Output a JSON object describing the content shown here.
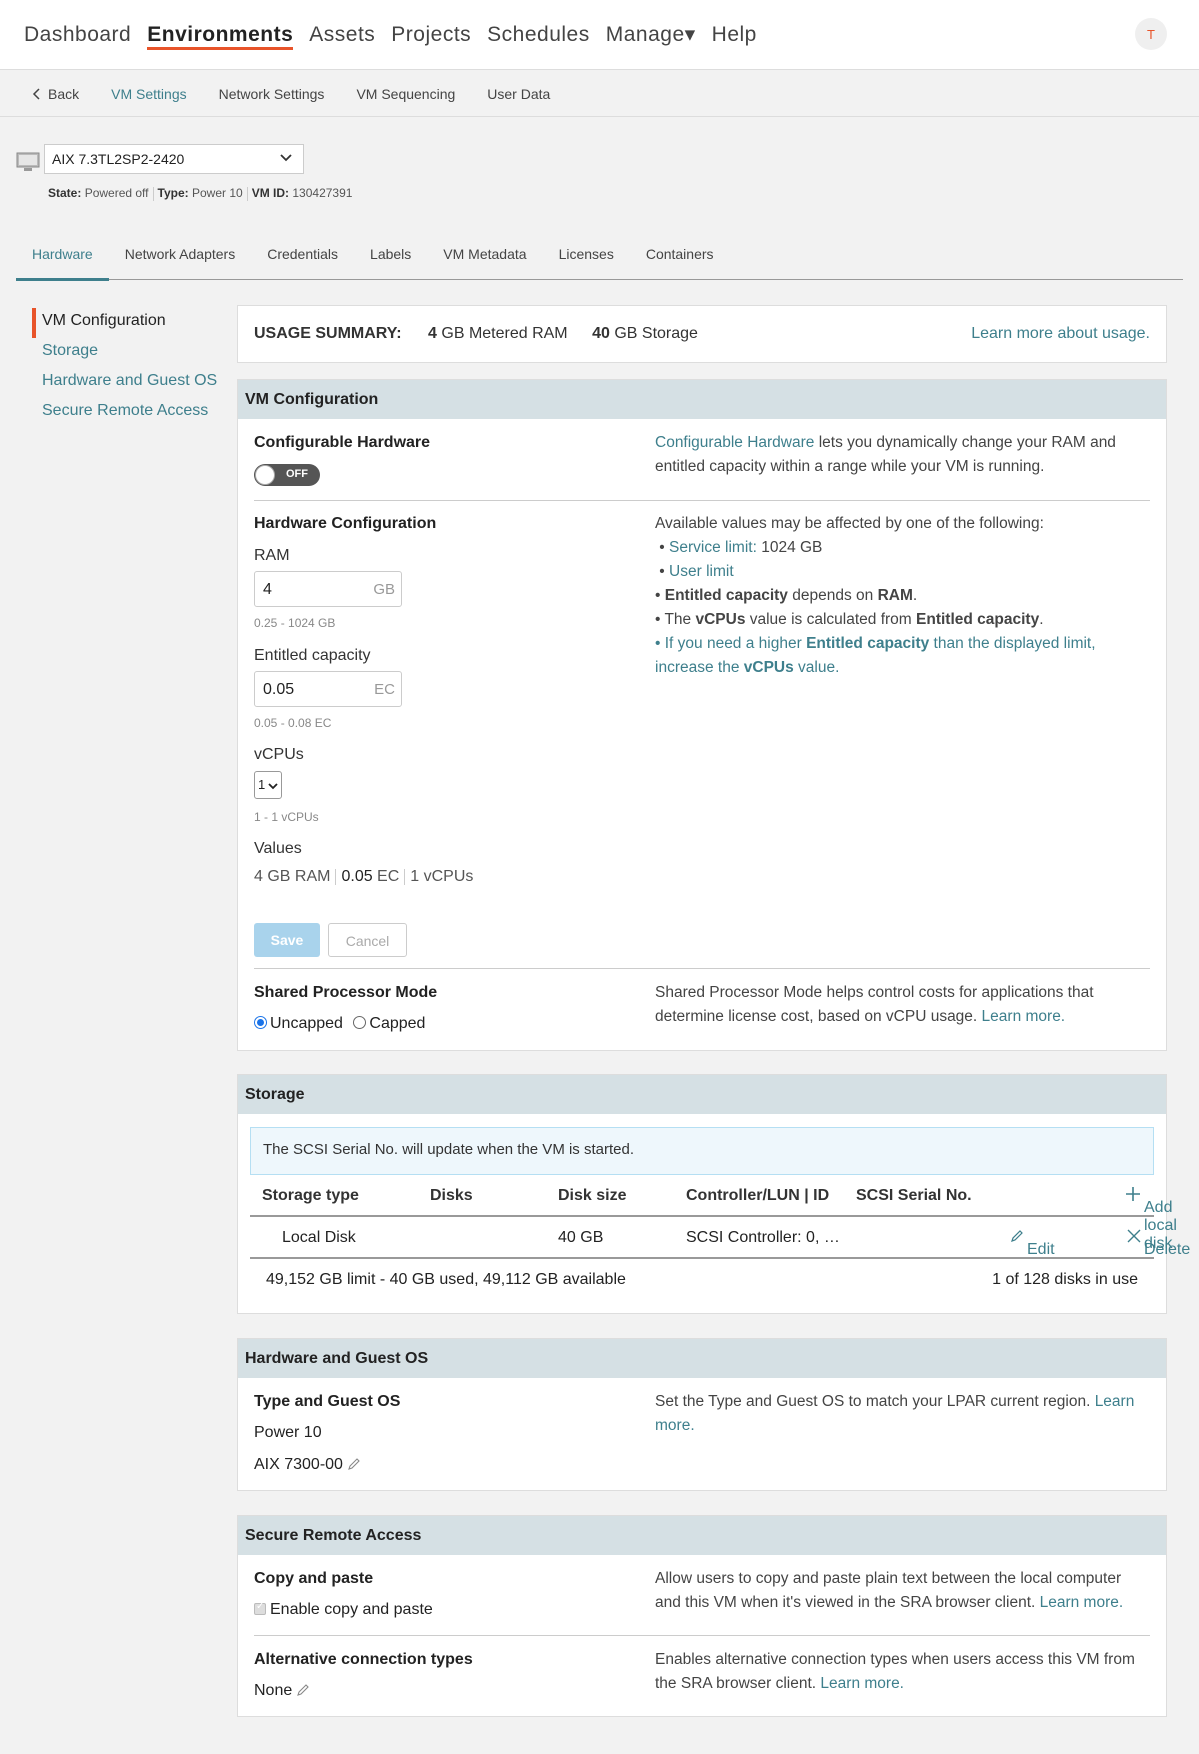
{
  "topnav": {
    "items": [
      "Dashboard",
      "Environments",
      "Assets",
      "Projects",
      "Schedules",
      "Manage▾",
      "Help"
    ],
    "avatar": "T"
  },
  "subnav": {
    "back": "Back",
    "items": [
      "VM Settings",
      "Network Settings",
      "VM Sequencing",
      "User Data"
    ]
  },
  "vm": {
    "name": "AIX 7.3TL2SP2-2420",
    "state_label": "State:",
    "state": "Powered off",
    "type_label": "Type:",
    "type": "Power 10",
    "id_label": "VM ID:",
    "id": "130427391"
  },
  "tabs": [
    "Hardware",
    "Network Adapters",
    "Credentials",
    "Labels",
    "VM Metadata",
    "Licenses",
    "Containers"
  ],
  "sidenav": [
    "VM Configuration",
    "Storage",
    "Hardware and Guest OS",
    "Secure Remote Access"
  ],
  "usage": {
    "label": "USAGE SUMMARY:",
    "ram_value": "4",
    "ram_unit": "GB Metered RAM",
    "storage_value": "40",
    "storage_unit": "GB Storage",
    "learn_more": "Learn more about usage."
  },
  "vmconfig": {
    "title": "VM Configuration",
    "configurable_hardware": "Configurable Hardware",
    "toggle": "OFF",
    "ch_link": "Configurable Hardware",
    "ch_desc": " lets you dynamically change your RAM and entitled capacity within a range while your VM is running.",
    "hardware_configuration": "Hardware Configuration",
    "ram_label": "RAM",
    "ram_value": "4",
    "ram_unit": "GB",
    "ram_hint": "0.25 - 1024 GB",
    "ec_label": "Entitled capacity",
    "ec_value": "0.05",
    "ec_unit": "EC",
    "ec_hint": "0.05 - 0.08 EC",
    "vcpu_label": "vCPUs",
    "vcpu_value": "1",
    "vcpu_hint": "1 - 1 vCPUs",
    "values_label": "Values",
    "values_ram": "4 GB RAM",
    "values_ec": "0.05",
    "values_ec_unit": " EC",
    "values_vcpu": "1 vCPUs",
    "save": "Save",
    "cancel": "Cancel",
    "avail_intro": "Available values may be affected by one of the following:",
    "service_limit": "Service limit:",
    "service_limit_value": " 1024 GB",
    "user_limit": "User limit",
    "bullet3_a": "Entitled capacity",
    "bullet3_b": " depends on ",
    "bullet3_c": "RAM",
    "bullet3_d": ".",
    "bullet4_a": "The ",
    "bullet4_b": "vCPUs",
    "bullet4_c": " value is calculated from ",
    "bullet4_d": "Entitled capacity",
    "bullet4_e": ".",
    "bullet5_a": "If you need a higher ",
    "bullet5_b": "Entitled capacity",
    "bullet5_c": " than the displayed limit, increase the ",
    "bullet5_d": "vCPUs",
    "bullet5_e": " value.",
    "spm_title": "Shared Processor Mode",
    "spm_uncapped": "Uncapped",
    "spm_capped": "Capped",
    "spm_desc": "Shared Processor Mode helps control costs for applications that determine license cost, based on vCPU usage. ",
    "spm_learn": "Learn more."
  },
  "storage": {
    "title": "Storage",
    "notice": "The SCSI Serial No. will update when the VM is started.",
    "columns": [
      "Storage type",
      "Disks",
      "Disk size",
      "Controller/LUN | ID",
      "SCSI Serial No."
    ],
    "add": "Add local disk",
    "row": {
      "type": "Local Disk",
      "size": "40 GB",
      "controller": "SCSI Controller: 0, …",
      "edit": "Edit",
      "delete": "Delete"
    },
    "limit": "49,152 GB limit - 40 GB used, 49,112 GB available",
    "disks": "1 of 128 disks in use"
  },
  "hwos": {
    "title": "Hardware and Guest OS",
    "heading": "Type and Guest OS",
    "type": "Power 10",
    "os": "AIX 7300-00",
    "desc": "Set the Type and Guest OS to match your LPAR current region. ",
    "learn": "Learn more."
  },
  "sra": {
    "title": "Secure Remote Access",
    "copy_title": "Copy and paste",
    "copy_check": "Enable copy and paste",
    "copy_desc": "Allow users to copy and paste plain text between the local computer and this VM when it's viewed in the SRA browser client. ",
    "copy_learn": "Learn more.",
    "alt_title": "Alternative connection types",
    "alt_value": "None",
    "alt_desc": "Enables alternative connection types when users access this VM from the SRA browser client. ",
    "alt_learn": "Learn more."
  },
  "colors": {
    "accent": "#e8542a",
    "link": "#3e7f8c",
    "panel_header": "#d5e0e4",
    "save_disabled": "#a9d3ec"
  }
}
